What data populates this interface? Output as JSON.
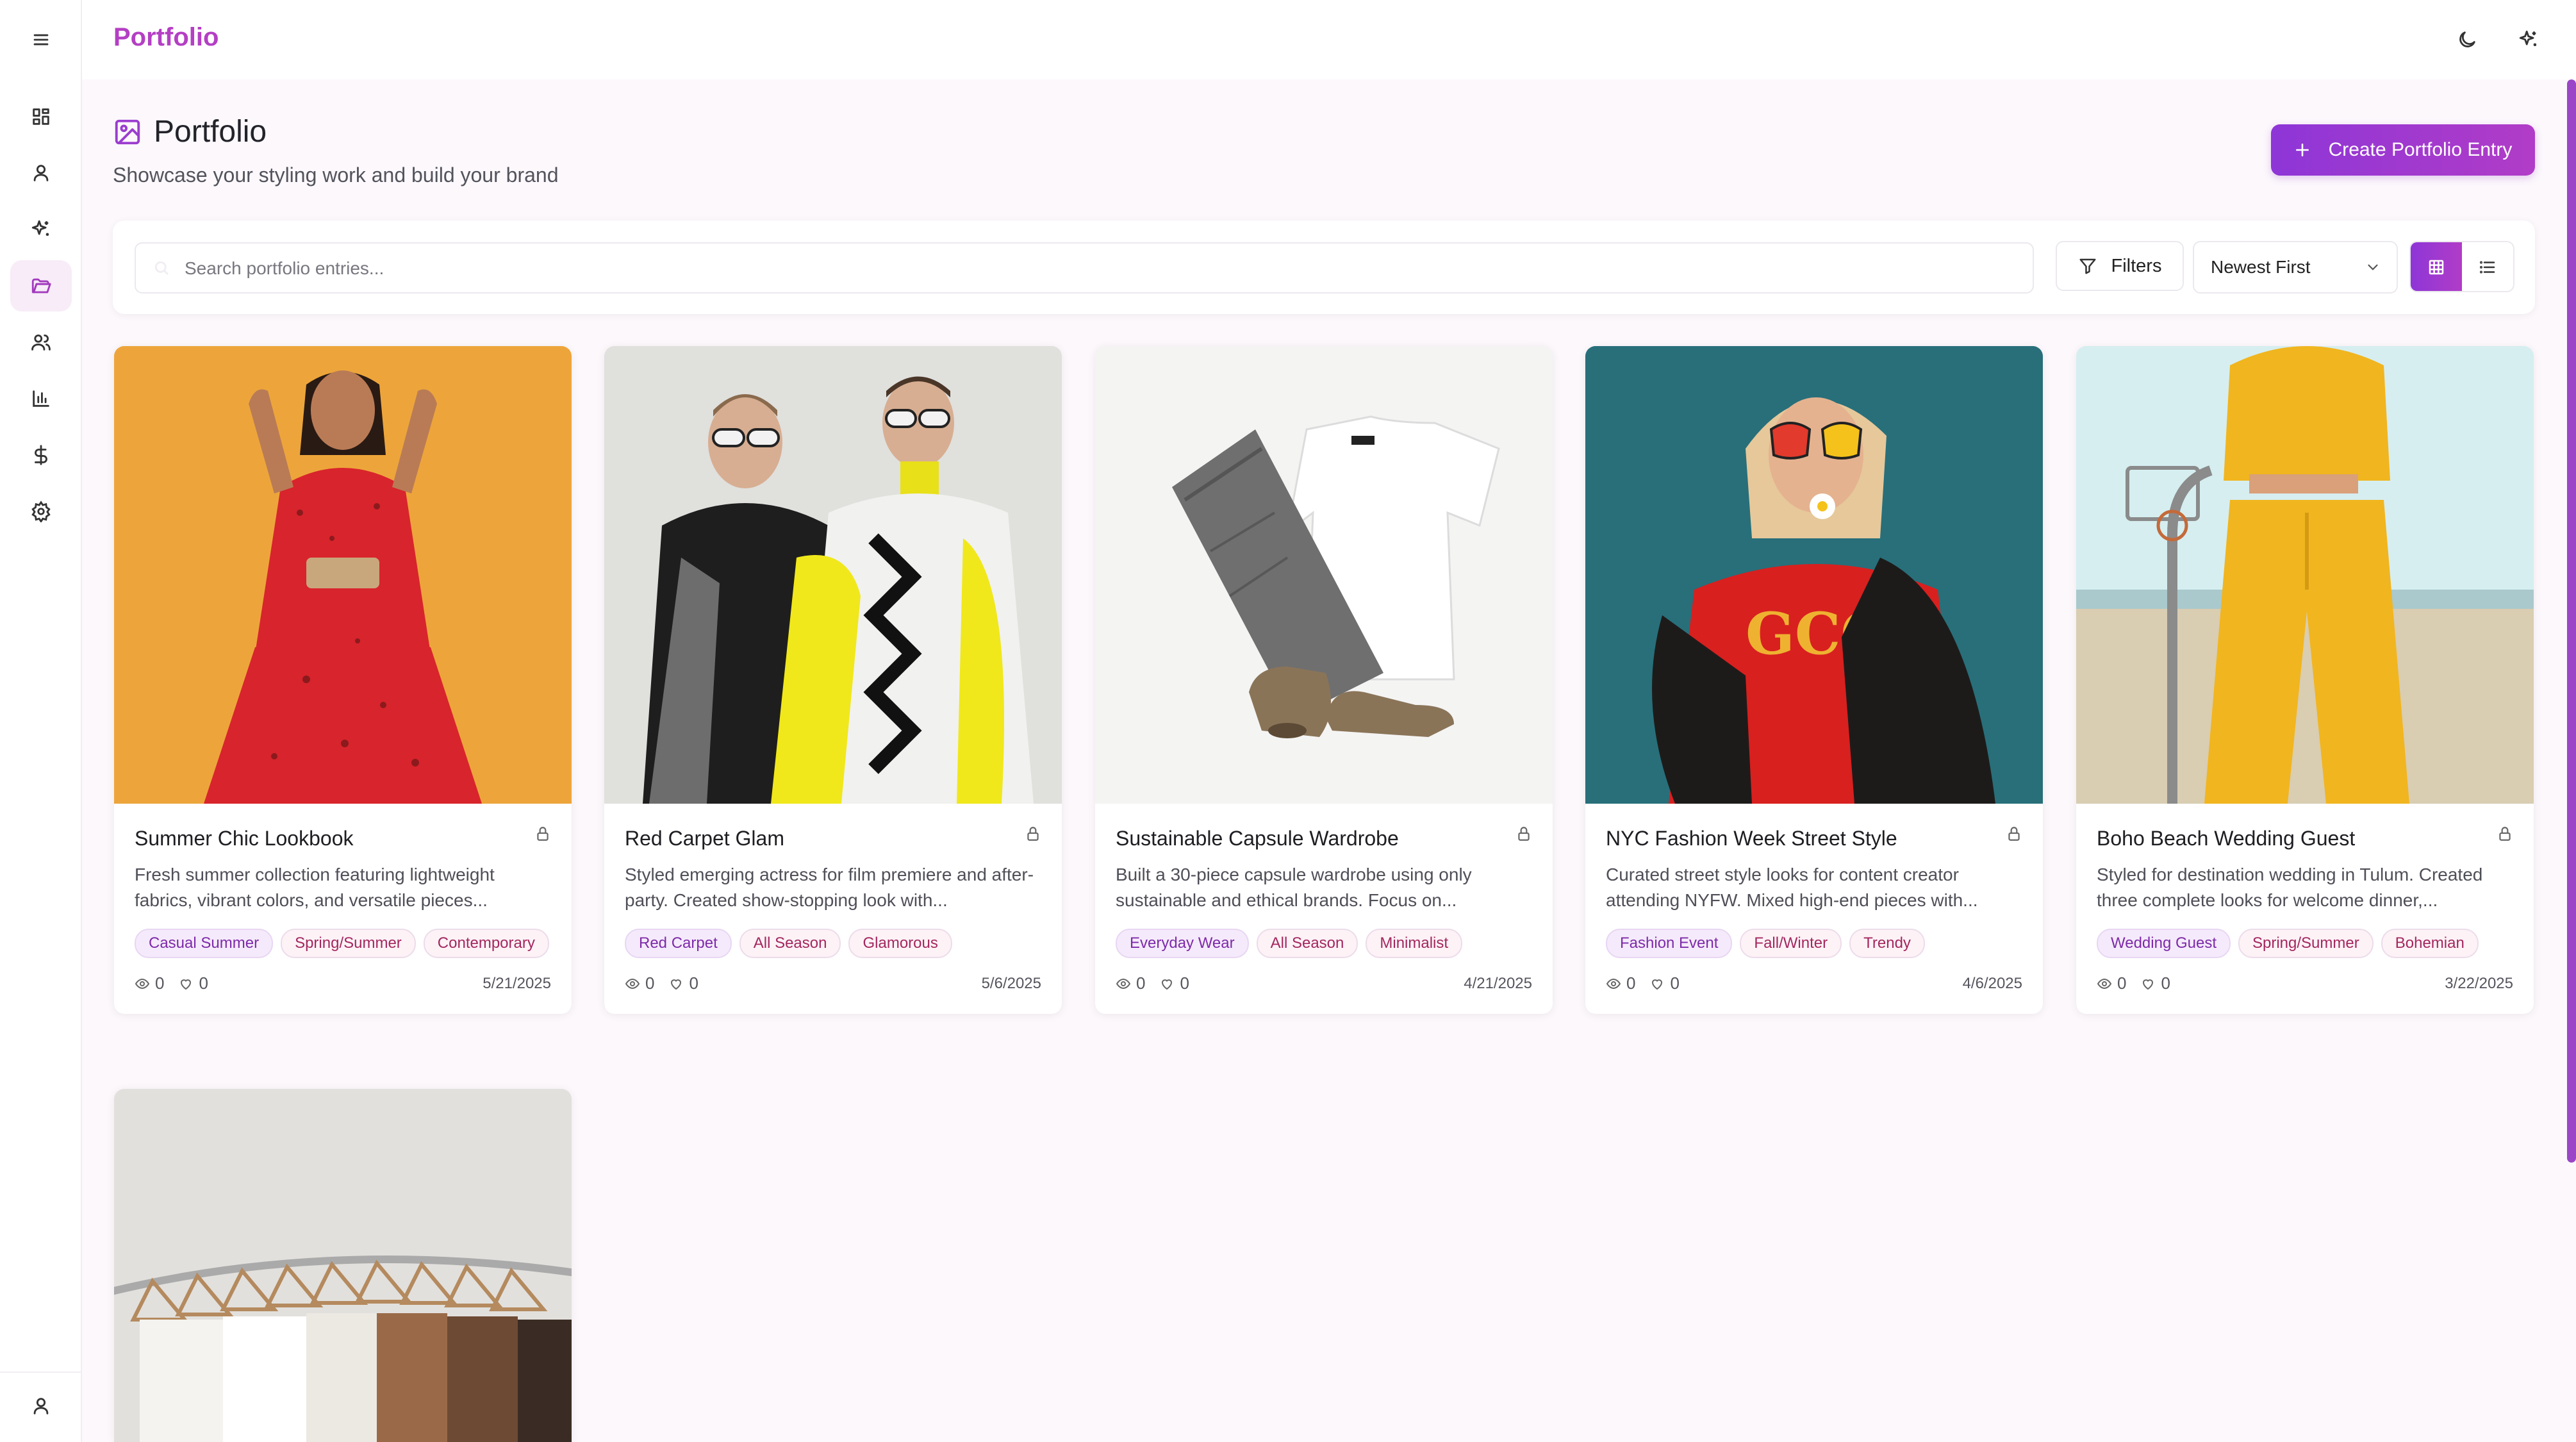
{
  "app": {
    "brand": "Portfolio"
  },
  "page": {
    "title": "Portfolio",
    "subtitle": "Showcase your styling work and build your brand",
    "create_button": "Create Portfolio Entry"
  },
  "toolbar": {
    "search_placeholder": "Search portfolio entries...",
    "filters_label": "Filters",
    "sort_value": "Newest First",
    "view_mode": "grid"
  },
  "sidebar": {
    "items": [
      {
        "icon": "dashboard-icon",
        "active": false
      },
      {
        "icon": "user-icon",
        "active": false
      },
      {
        "icon": "sparkles-icon",
        "active": false
      },
      {
        "icon": "folder-icon",
        "active": true
      },
      {
        "icon": "users-icon",
        "active": false
      },
      {
        "icon": "bar-chart-icon",
        "active": false
      },
      {
        "icon": "dollar-icon",
        "active": false
      },
      {
        "icon": "settings-icon",
        "active": false
      }
    ],
    "bottom_icon": "user-icon"
  },
  "cards": [
    {
      "title": "Summer Chic Lookbook",
      "description": "Fresh summer collection featuring lightweight fabrics, vibrant colors, and versatile pieces...",
      "tags": [
        "Casual Summer",
        "Spring/Summer",
        "Contemporary"
      ],
      "views": "0",
      "likes": "0",
      "date": "5/21/2025"
    },
    {
      "title": "Red Carpet Glam",
      "description": "Styled emerging actress for film premiere and after-party. Created show-stopping look with...",
      "tags": [
        "Red Carpet",
        "All Season",
        "Glamorous"
      ],
      "views": "0",
      "likes": "0",
      "date": "5/6/2025"
    },
    {
      "title": "Sustainable Capsule Wardrobe",
      "description": "Built a 30-piece capsule wardrobe using only sustainable and ethical brands. Focus on...",
      "tags": [
        "Everyday Wear",
        "All Season",
        "Minimalist"
      ],
      "views": "0",
      "likes": "0",
      "date": "4/21/2025"
    },
    {
      "title": "NYC Fashion Week Street Style",
      "description": "Curated street style looks for content creator attending NYFW. Mixed high-end pieces with...",
      "tags": [
        "Fashion Event",
        "Fall/Winter",
        "Trendy"
      ],
      "views": "0",
      "likes": "0",
      "date": "4/6/2025"
    },
    {
      "title": "Boho Beach Wedding Guest",
      "description": "Styled for destination wedding in Tulum. Created three complete looks for welcome dinner,...",
      "tags": [
        "Wedding Guest",
        "Spring/Summer",
        "Bohemian"
      ],
      "views": "0",
      "likes": "0",
      "date": "3/22/2025"
    }
  ],
  "colors": {
    "accent": "#9b3dcf",
    "brand": "#b43fc4",
    "tag_purple": "#7d2aa9",
    "tag_pink": "#a3275f"
  }
}
